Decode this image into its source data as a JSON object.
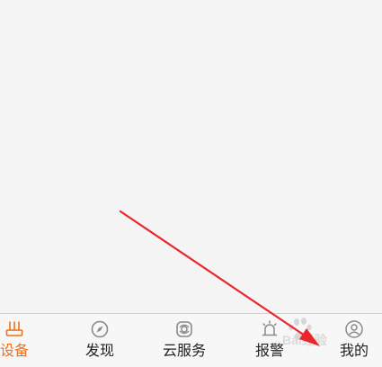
{
  "tabbar": {
    "items": [
      {
        "label": "设备",
        "icon": "router-icon",
        "active": true
      },
      {
        "label": "发现",
        "icon": "compass-icon",
        "active": false
      },
      {
        "label": "云服务",
        "icon": "cloud-service-icon",
        "active": false
      },
      {
        "label": "报警",
        "icon": "alarm-icon",
        "active": false
      },
      {
        "label": "我的",
        "icon": "profile-icon",
        "active": false
      }
    ],
    "active_color": "#e8721e",
    "inactive_color": "#222222",
    "icon_color": "#8a8a8a"
  },
  "annotation": {
    "color": "#e8262b"
  },
  "watermark": {
    "text": "Bai经验"
  }
}
